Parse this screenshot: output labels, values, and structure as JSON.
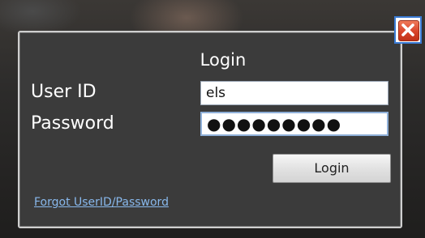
{
  "dialog": {
    "title": "Login",
    "user_id_label": "User ID",
    "password_label": "Password",
    "user_id_value": "els",
    "password_value": "●●●●●●●●●",
    "login_button_label": "Login",
    "forgot_link": "Forgot UserID/Password",
    "close_icon": "close-icon"
  },
  "colors": {
    "panel_background": "#3b3b3b",
    "link": "#88b8ec",
    "close_button": "#d8442a"
  }
}
